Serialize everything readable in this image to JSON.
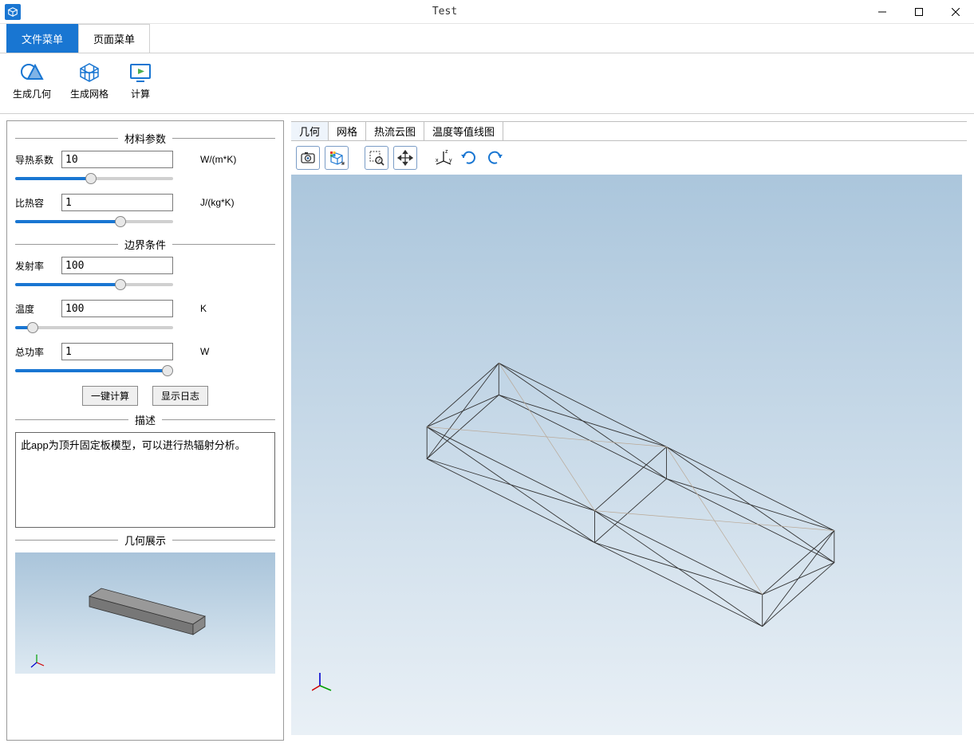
{
  "window": {
    "title": "Test"
  },
  "ribbon": {
    "tabs": [
      {
        "label": "文件菜单",
        "active": true
      },
      {
        "label": "页面菜单",
        "active": false
      }
    ],
    "items": [
      {
        "label": "生成几何",
        "icon": "geometry-icon"
      },
      {
        "label": "生成网格",
        "icon": "mesh-icon"
      },
      {
        "label": "计算",
        "icon": "compute-icon"
      }
    ]
  },
  "sidebar": {
    "sections": {
      "material": {
        "title": "材料参数",
        "params": [
          {
            "label": "导热系数",
            "value": "10",
            "unit": "W/(m*K)",
            "slider_pct": 48
          },
          {
            "label": "比热容",
            "value": "1",
            "unit": "J/(kg*K)",
            "slider_pct": 68
          }
        ]
      },
      "boundary": {
        "title": "边界条件",
        "params": [
          {
            "label": "发射率",
            "value": "100",
            "unit": "",
            "slider_pct": 68
          },
          {
            "label": "温度",
            "value": "100",
            "unit": "K",
            "slider_pct": 8
          },
          {
            "label": "总功率",
            "value": "1",
            "unit": "W",
            "slider_pct": 100
          }
        ]
      }
    },
    "buttons": {
      "compute": "一键计算",
      "show_log": "显示日志"
    },
    "description": {
      "title": "描述",
      "text": "此app为顶升固定板模型，可以进行热辐射分析。"
    },
    "geom_preview": {
      "title": "几何展示"
    }
  },
  "canvas": {
    "tabs": [
      {
        "label": "几何",
        "active": true
      },
      {
        "label": "网格",
        "active": false
      },
      {
        "label": "热流云图",
        "active": false
      },
      {
        "label": "温度等值线图",
        "active": false
      }
    ],
    "toolbar_icons": [
      "screenshot-icon",
      "scene-light-icon",
      "zoom-box-icon",
      "pan-icon",
      "axes-icon",
      "rotate-cw-icon",
      "rotate-ccw-icon"
    ]
  }
}
